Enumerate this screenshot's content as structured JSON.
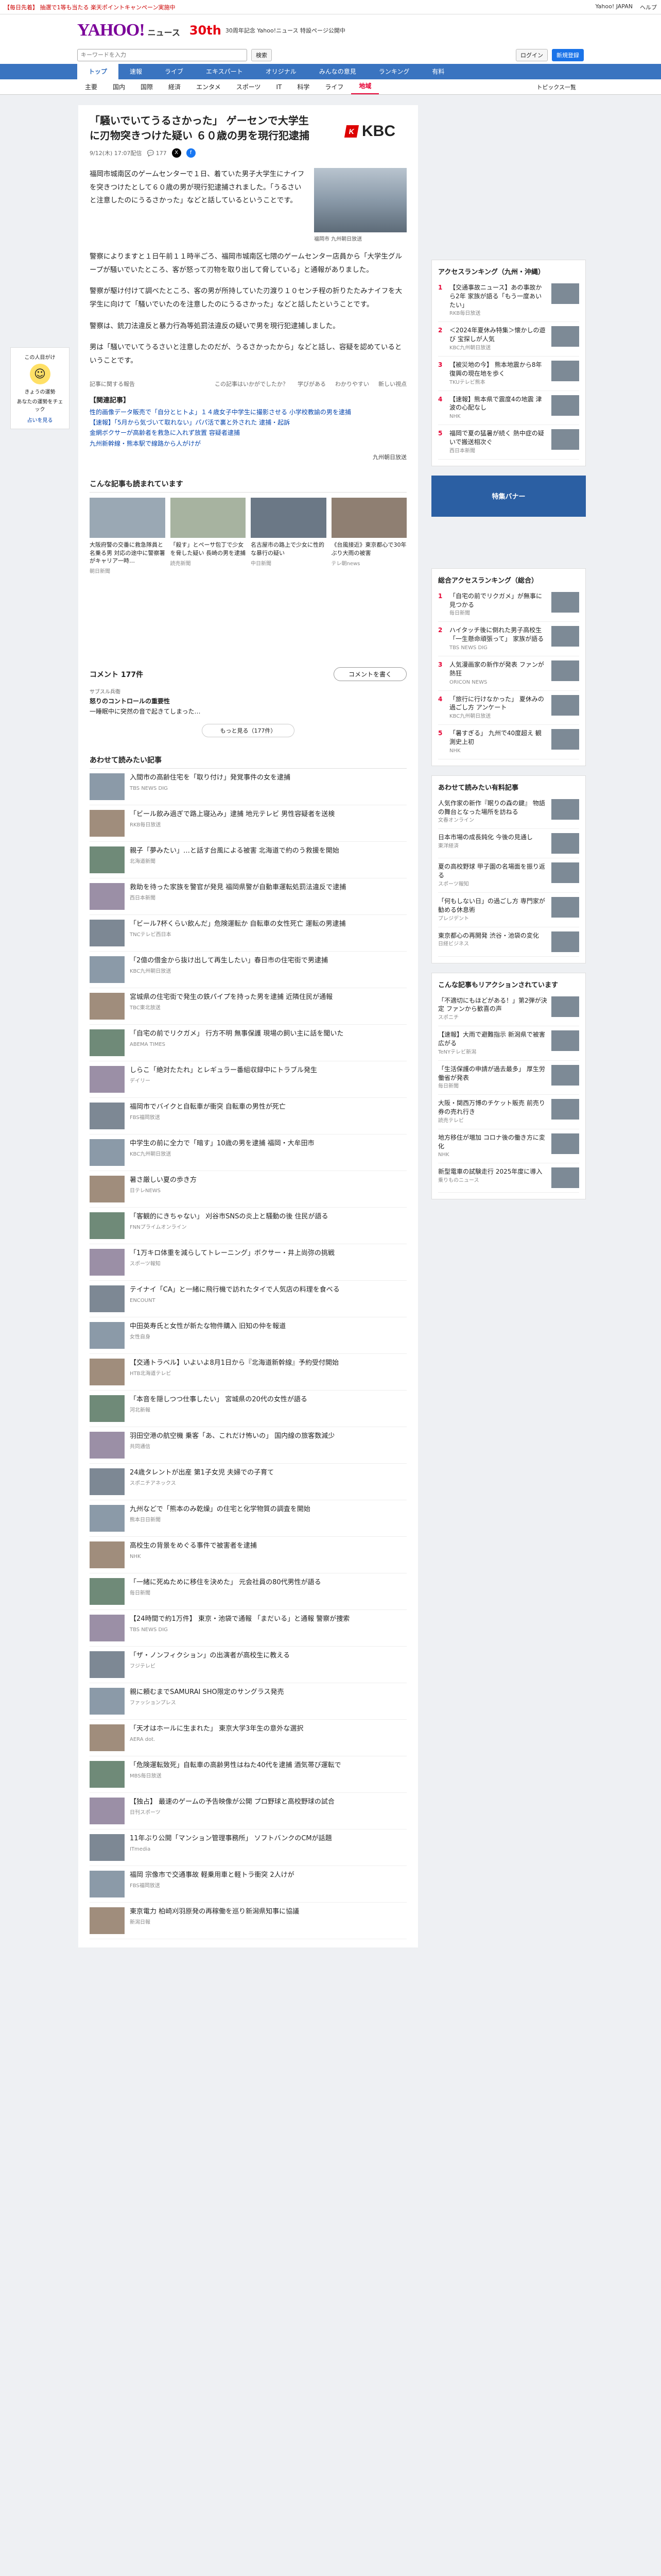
{
  "topbar": {
    "notice": "【毎日先着】 抽選で1等も当たる 楽天ポイントキャンペーン実施中",
    "links": [
      "Yahoo! JAPAN",
      "ヘルプ"
    ]
  },
  "brand": {
    "logo": "YAHOO!",
    "logo_sub": "ニュース",
    "anni": "30th",
    "anni_text": "30周年記念 Yahoo!ニュース 特設ページ公開中",
    "links": [
      "Yahoo! JAPAN",
      "ヘルプ"
    ]
  },
  "search": {
    "placeholder": "キーワードを入力",
    "button": "検索",
    "labels": [
      "ログイン",
      "新規登録"
    ]
  },
  "nav": {
    "tabs": [
      "トップ",
      "速報",
      "ライブ",
      "エキスパート",
      "オリジナル",
      "みんなの意見",
      "ランキング",
      "有料"
    ]
  },
  "subnav": {
    "tabs": [
      "主要",
      "国内",
      "国際",
      "経済",
      "エンタメ",
      "スポーツ",
      "IT",
      "科学",
      "ライフ",
      "地域"
    ],
    "topics": "トピックス一覧"
  },
  "leftad": {
    "text1": "この人目がけ",
    "text2": "きょうの運勢",
    "text3": "あなたの運勢をチェック",
    "link": "占いを見る"
  },
  "article": {
    "title": "「騒いでいてうるさかった」 ゲーセンで大学生に刃物突きつけた疑い ６０歳の男を現行犯逮捕",
    "date": "9/12(木) 17:07配信",
    "comments": "177",
    "source_logo": "KBC",
    "lead": "福岡市城南区のゲームセンターで１日、着ていた男子大学生にナイフを突きつけたとして６０歳の男が現行犯逮捕されました。「うるさいと注意したのにうるさかった」などと話しているということです。",
    "p1": "警察によりますと１日午前１１時半ごろ、福岡市城南区七隈のゲームセンター店員から「大学生グループが騒いでいたところ、客が怒って刃物を取り出して脅している」と通報がありました。",
    "p2": "警察が駆け付けて調べたところ、客の男が所持していた刃渡り１０センチ程の折りたたみナイフを大学生に向けて「騒いでいたのを注意したのにうるさかった」などと話したということです。",
    "p3": "警察は、銃刀法違反と暴力行為等処罰法違反の疑いで男を現行犯逮捕しました。",
    "p4": "男は「騒いでいてうるさいと注意したのだが、うるさかったから」などと話し、容疑を認めているということです。",
    "photo_caption": "福岡市 九州朝日放送",
    "actions": [
      "記事に関する報告",
      "この記事はいかがでしたか？",
      "学びがある",
      "わかりやすい",
      "新しい視点"
    ],
    "related_title": "【関連記事】",
    "related": [
      "性的画像データ販売で「自分とヒトよ」１４歳女子中学生に撮影させる 小学校教諭の男を逮捕",
      "【速報】「5月から気づいて取れない」パパ活で裏と外された 逮捕・起訴",
      "金網ボクサーが高齢者を救急に入れず放置 容疑者逮捕",
      "九州新幹線・熊本駅で線路から人がけが"
    ],
    "source": "九州朝日放送"
  },
  "recs": {
    "title": "こんな記事も読まれています",
    "items": [
      {
        "t": "大阪府警の交番に救急隊員と名乗る男 対応の途中に警察署がキャリア一時…",
        "s": "朝日新聞"
      },
      {
        "t": "「殺す」とペーサ包丁で少女を脅した疑い 長崎の男を逮捕",
        "s": "読売新聞"
      },
      {
        "t": "名古屋市の路上で少女に性的な暴行の疑い",
        "s": "中日新聞"
      },
      {
        "t": "《台風接近》東京都心で30年ぶり大雨の被害",
        "s": "テレ朝news"
      }
    ]
  },
  "comments": {
    "title": "コメント",
    "count": "177件",
    "post": "コメントを書く",
    "sample_user": "サブスル兵衛",
    "sample_head": "怒りのコントロールの重要性",
    "sample_body": "一睡眠中に突然の音で起きてしまった…",
    "more": "もっと見る（177件）"
  },
  "also": {
    "title": "あわせて読みたい記事",
    "items": [
      {
        "t": "入間市の高齢住宅を「取り付け」発覚事件の女を逮捕",
        "s": "TBS NEWS DIG"
      },
      {
        "t": "「ビール飲み過ぎで路上寝込み」逮捕 地元テレビ 男性容疑者を送検",
        "s": "RKB毎日放送"
      },
      {
        "t": "親子「夢みたい」…と話す台風による被害 北海道で約のう救援を開始",
        "s": "北海道新聞"
      },
      {
        "t": "救助を待った家族を警官が発見 福岡県警が自動車運転処罰法違反で逮捕",
        "s": "西日本新聞"
      },
      {
        "t": "「ビール7杯くらい飲んだ」危険運転か 自転車の女性死亡 運転の男逮捕",
        "s": "TNCテレビ西日本"
      },
      {
        "t": "「2億の借金から抜け出して再生したい」春日市の住宅街で男逮捕",
        "s": "KBC九州朝日放送"
      },
      {
        "t": "宮城県の住宅街で発生の鉄パイプを持った男を逮捕 近隣住民が通報",
        "s": "TBC東北放送"
      },
      {
        "t": "「自宅の前でリクガメ」 行方不明 無事保護 現場の飼い主に話を聞いた",
        "s": "ABEMA TIMES"
      },
      {
        "t": "しらこ「絶対たたれ」とレギュラー番組収録中にトラブル発生",
        "s": "デイリー"
      },
      {
        "t": "福岡市でバイクと自転車が衝突 自転車の男性が死亡",
        "s": "FBS福岡放送"
      },
      {
        "t": "中学生の前に全力で「暗す」10歳の男を逮捕 福岡・大牟田市",
        "s": "KBC九州朝日放送"
      },
      {
        "t": "暑さ厳しい夏の歩き方",
        "s": "日テレNEWS"
      },
      {
        "t": "「客観的にきちゃない」 刈谷市SNSの炎上と騒動の後 住民が語る",
        "s": "FNNプライムオンライン"
      },
      {
        "t": "「1万キロ体重を減らしてトレーニング」ボクサー・井上尚弥の挑戦",
        "s": "スポーツ報知"
      },
      {
        "t": "テイナイ「CA」と一緒に飛行機で訪れたタイで人気店の料理を食べる",
        "s": "ENCOUNT"
      },
      {
        "t": "中田英寿氏と女性が新たな物件購入 旧知の仲を報道",
        "s": "女性自身"
      },
      {
        "t": "【交通トラベル】いよいよ8月1日から『北海道新幹線』予約受付開始",
        "s": "HTB北海道テレビ"
      },
      {
        "t": "「本音を隠しつつ仕事したい」 宮城県の20代の女性が語る",
        "s": "河北新報"
      },
      {
        "t": "羽田空港の航空機 乗客「あ、これだけ怖いの」 国内線の旅客数減少",
        "s": "共同通信"
      },
      {
        "t": "24歳タレントが出産 第1子女児 夫婦での子育て",
        "s": "スポニチアネックス"
      },
      {
        "t": "九州などで「熊本のみ乾燥」の住宅と化学物質の調査を開始",
        "s": "熊本日日新聞"
      },
      {
        "t": "高校生の背景をめぐる事件で被害者を逮捕",
        "s": "NHK"
      },
      {
        "t": "「一緒に死ぬために移住を決めた」 元会社員の80代男性が語る",
        "s": "毎日新聞"
      },
      {
        "t": "【24時間で約1万件】 東京・池袋で通報 「まだいる」と通報 警察が捜索",
        "s": "TBS NEWS DIG"
      },
      {
        "t": "「ザ・ノンフィクション」の出演者が高校生に教える",
        "s": "フジテレビ"
      },
      {
        "t": "親に頼むまでSAMURAI SHO限定のサングラス発売",
        "s": "ファッションプレス"
      },
      {
        "t": "「天才はホールに生まれた」 東京大学3年生の意外な選択",
        "s": "AERA dot."
      },
      {
        "t": "「危険運転致死」自転車の高齢男性はねた40代を逮捕 酒気帯び運転で",
        "s": "MBS毎日放送"
      },
      {
        "t": "【独占】 最速のゲームの予告映像が公開 プロ野球と高校野球の試合",
        "s": "日刊スポーツ"
      },
      {
        "t": "11年ぶり公開「マンション管理事務所」 ソフトバンクのCMが話題",
        "s": "ITmedia"
      },
      {
        "t": "福岡 宗像市で交通事故 軽乗用車と軽トラ衝突 2人けが",
        "s": "FBS福岡放送"
      },
      {
        "t": "東京電力 柏崎刈羽原発の再稼働を巡り新潟県知事に協議",
        "s": "新潟日報"
      }
    ]
  },
  "side": {
    "ranking_title": "アクセスランキング（九州・沖縄）",
    "ranking": [
      {
        "t": "【交通事故ニュース】あの事故から2年 家族が語る「もう一度あいたい」",
        "s": "RKB毎日放送"
      },
      {
        "t": "＜2024年夏休み特集＞懐かしの遊び 宝探しが人気",
        "s": "KBC九州朝日放送"
      },
      {
        "t": "【被災地の今】 熊本地震から8年 復興の現在地を歩く",
        "s": "TKUテレビ熊本"
      },
      {
        "t": "【速報】熊本県で震度4の地震 津波の心配なし",
        "s": "NHK"
      },
      {
        "t": "福岡で夏の猛暑が続く 熱中症の疑いで搬送相次ぐ",
        "s": "西日本新聞"
      }
    ],
    "banner": "特集バナー",
    "national_title": "総合アクセスランキング（総合）",
    "national": [
      {
        "t": "「自宅の前でリクガメ」が無事に見つかる",
        "s": "毎日新聞"
      },
      {
        "t": "ハイタッチ後に倒れた男子高校生 「一生懸命頑張って」 家族が語る",
        "s": "TBS NEWS DIG"
      },
      {
        "t": "人気漫画家の新作が発表 ファンが熱狂",
        "s": "ORICON NEWS"
      },
      {
        "t": "「旅行に行けなかった」 夏休みの過ごし方 アンケート",
        "s": "KBC九州朝日放送"
      },
      {
        "t": "「暑すぎる」 九州で40度超え 観測史上初",
        "s": "NHK"
      }
    ],
    "expert_title": "あわせて読みたい有料記事",
    "expert": [
      {
        "t": "人気作家の新作『眠りの森の鍵』 物語の舞台となった場所を訪ねる",
        "s": "文春オンライン"
      },
      {
        "t": "日本市場の成長鈍化 今後の見通し",
        "s": "東洋経済"
      },
      {
        "t": "夏の高校野球 甲子園の名場面を振り返る",
        "s": "スポーツ報知"
      },
      {
        "t": "「何もしない日」の過ごし方 専門家が勧める休息術",
        "s": "プレジデント"
      },
      {
        "t": "東京都心の再開発 渋谷・池袋の変化",
        "s": "日経ビジネス"
      }
    ],
    "reaction_title": "こんな記事もリアクションされています",
    "reaction": [
      {
        "t": "「不適切にもほどがある！」第2弾が決定 ファンから歓喜の声",
        "s": "スポニチ"
      },
      {
        "t": "【速報】大雨で避難指示 新潟県で被害広がる",
        "s": "TeNYテレビ新潟"
      },
      {
        "t": "「生活保護の申請が過去最多」 厚生労働省が発表",
        "s": "毎日新聞"
      },
      {
        "t": "大阪・関西万博のチケット販売 前売り券の売れ行き",
        "s": "読売テレビ"
      },
      {
        "t": "地方移住が増加 コロナ後の働き方に変化",
        "s": "NHK"
      },
      {
        "t": "新型電車の試験走行 2025年度に導入",
        "s": "乗りものニュース"
      }
    ]
  }
}
